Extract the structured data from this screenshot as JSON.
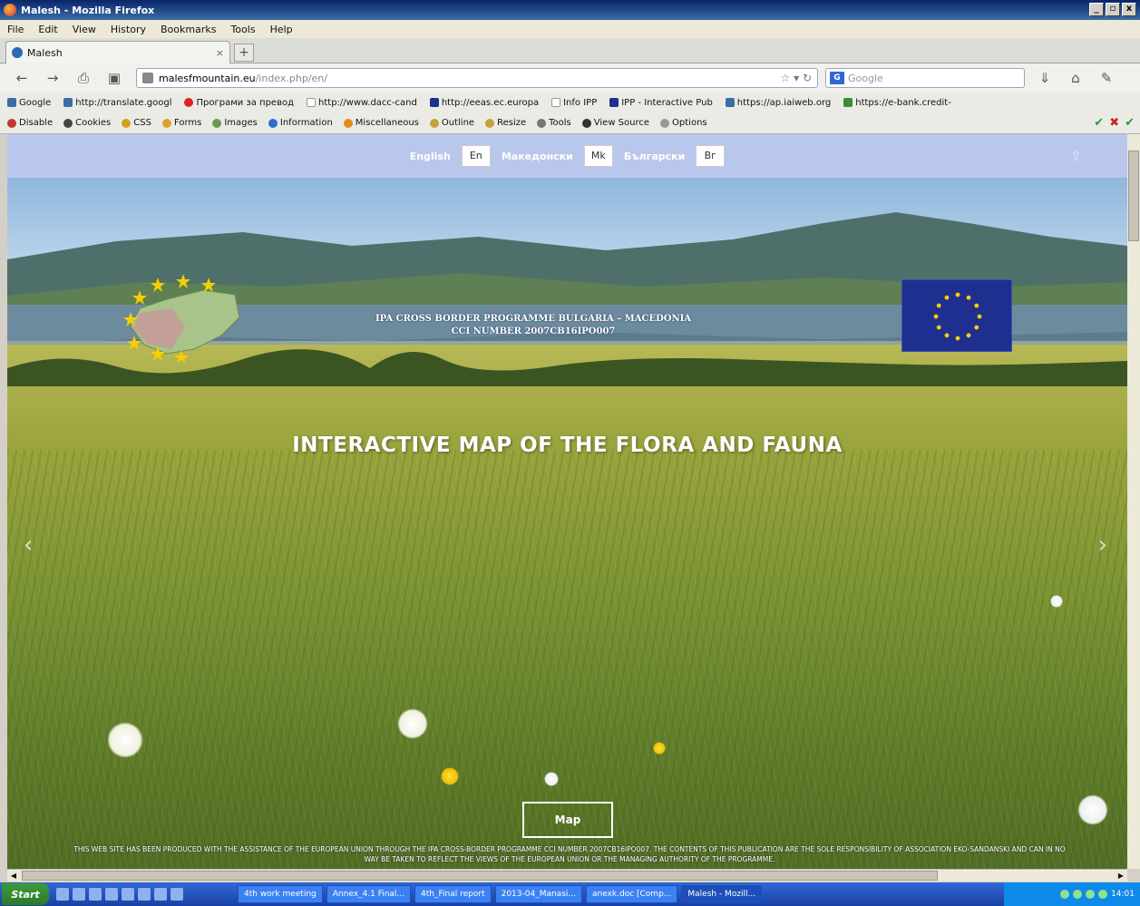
{
  "window": {
    "title": "Malesh - Mozilla Firefox",
    "buttons": [
      "_",
      "▫",
      "x"
    ]
  },
  "menu": [
    "File",
    "Edit",
    "View",
    "History",
    "Bookmarks",
    "Tools",
    "Help"
  ],
  "tab": {
    "title": "Malesh",
    "close": "×",
    "new": "+"
  },
  "nav": {
    "url_host": "malesfmountain.eu",
    "url_path": "/index.php/en/",
    "search_placeholder": "Google",
    "search_engine": "G"
  },
  "bookmarks": [
    "Google",
    "http://translate.googl",
    "Програми за превод",
    "http://www.dacc-cand",
    "http://eeas.ec.europa",
    "Info IPP",
    "IPP - Interactive Pub",
    "https://ap.iaiweb.org",
    "https://e-bank.credit-"
  ],
  "devtools": [
    "Disable",
    "Cookies",
    "CSS",
    "Forms",
    "Images",
    "Information",
    "Miscellaneous",
    "Outline",
    "Resize",
    "Tools",
    "View Source",
    "Options"
  ],
  "devstatus": [
    "✔",
    "✖",
    "✔"
  ],
  "langbar": {
    "items": [
      {
        "label": "English",
        "code": "En"
      },
      {
        "label": "Македонски",
        "code": "Mk"
      },
      {
        "label": "Български",
        "code": "Bг"
      }
    ],
    "up_arrow": "⇧"
  },
  "hero": {
    "banner_line1": "IPA CROSS BORDER PROGRAMME BULGARIA – MACEDONIA",
    "banner_line2": "CCI NUMBER 2007CB16IPO007",
    "title": "INTERACTIVE MAP OF THE FLORA AND FAUNA",
    "map_button": "Map",
    "prev": "‹",
    "next": "›",
    "disclaimer": "THIS WEB SITE HAS BEEN PRODUCED WITH THE ASSISTANCE OF THE EUROPEAN UNION THROUGH THE IPA CROSS-BORDER PROGRAMME CCI NUMBER 2007CB16IPO007. THE CONTENTS OF THIS PUBLICATION ARE THE SOLE RESPONSIBILITY OF ASSOCIATION EKO-SANDANSKI AND CAN IN NO WAY BE TAKEN TO REFLECT THE VIEWS OF THE EUROPEAN UNION OR THE MANAGING AUTHORITY OF THE PROGRAMME."
  },
  "taskbar": {
    "start": "Start",
    "items": [
      "4th work meeting",
      "Annex_4.1 Final...",
      "4th_Final report",
      "2013-04_Manasi...",
      "anexk.doc [Comp...",
      "Malesh - Mozill..."
    ],
    "clock": "14:01"
  },
  "colors": {
    "langbar": "#b9c7ec",
    "eu_blue": "#1f2f8f",
    "eu_gold": "#f5d000",
    "taskbar": "#1941a5"
  }
}
